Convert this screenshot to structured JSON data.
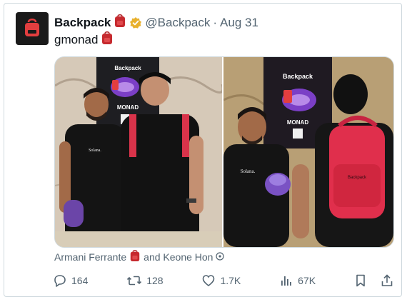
{
  "post": {
    "name": "Backpack",
    "handle": "@Backpack",
    "separator": "·",
    "date": "Aug 31",
    "text": "gmonad",
    "caption_text": "Armani Ferrante",
    "caption_connector": "and Keone Hon",
    "avatar_icon": "red-backpack-icon",
    "emoji_icon": "red-backpack-emoji-icon"
  },
  "media": {
    "left_photo": {
      "banner_title": "Backpack",
      "banner_subtitle": "MONAD",
      "shirt_text": "Solana."
    },
    "right_photo": {
      "banner_title": "Backpack",
      "banner_subtitle": "MONAD",
      "shirt_text": "Solana.",
      "bag_text": "Backpack"
    }
  },
  "actions": {
    "replies": "164",
    "reposts": "128",
    "likes": "1.7K",
    "views": "67K"
  },
  "colors": {
    "backpack_red": "#e33e3f",
    "verified_gold": "#e8b12e",
    "muted": "#536471",
    "border": "#cfd9de"
  }
}
